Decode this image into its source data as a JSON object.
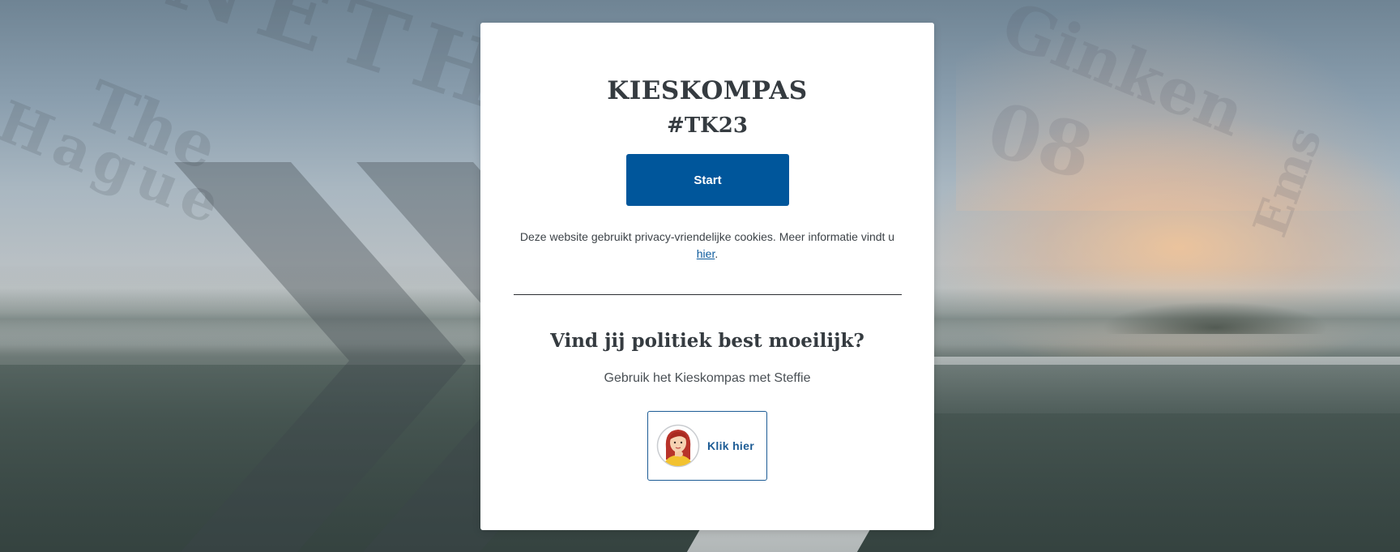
{
  "page": {
    "title": "KIESKOMPAS",
    "subtitle": "#TK23"
  },
  "start": {
    "label": "Start"
  },
  "cookie": {
    "text": "Deze website gebruikt privacy-vriendelijke cookies. Meer informatie vindt u",
    "link_label": "hier",
    "suffix": "."
  },
  "steffie": {
    "heading": "Vind jij politiek best moeilijk?",
    "text": "Gebruik het Kieskompas met Steffie",
    "button_label": "Klik hier",
    "avatar_icon": "steffie-avatar-icon"
  },
  "colors": {
    "primary": "#00569b",
    "link": "#0d5b9d",
    "text": "#353b40"
  }
}
